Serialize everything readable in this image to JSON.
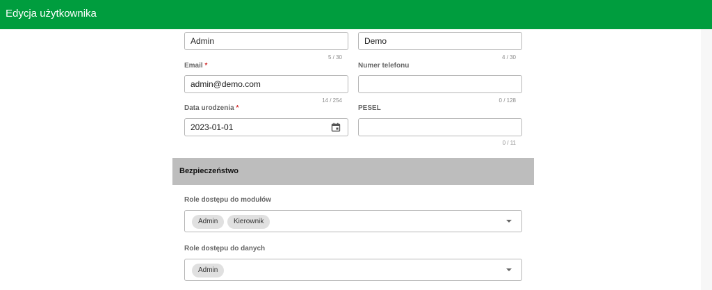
{
  "header": {
    "title": "Edycja użytkownika"
  },
  "form": {
    "first_name": {
      "value": "Admin",
      "counter": "5 / 30"
    },
    "last_name": {
      "value": "Demo",
      "counter": "4 / 30"
    },
    "email": {
      "label": "Email",
      "required_mark": "*",
      "value": "admin@demo.com",
      "counter": "14 / 254"
    },
    "phone": {
      "label": "Numer telefonu",
      "value": "",
      "counter": "0 / 128"
    },
    "birth_date": {
      "label": "Data urodzenia",
      "required_mark": "*",
      "value": "2023-01-01",
      "icon": "calendar-icon"
    },
    "pesel": {
      "label": "PESEL",
      "value": "",
      "counter": "0 / 11"
    }
  },
  "security": {
    "title": "Bezpieczeństwo",
    "module_roles": {
      "label": "Role dostępu do modułów",
      "chips": [
        "Admin",
        "Kierownik"
      ]
    },
    "data_roles": {
      "label": "Role dostępu do danych",
      "chips": [
        "Admin"
      ]
    }
  },
  "colors": {
    "header_bg": "#009d3e",
    "section_bg": "#bdbdbd",
    "required": "#d32f2f"
  }
}
